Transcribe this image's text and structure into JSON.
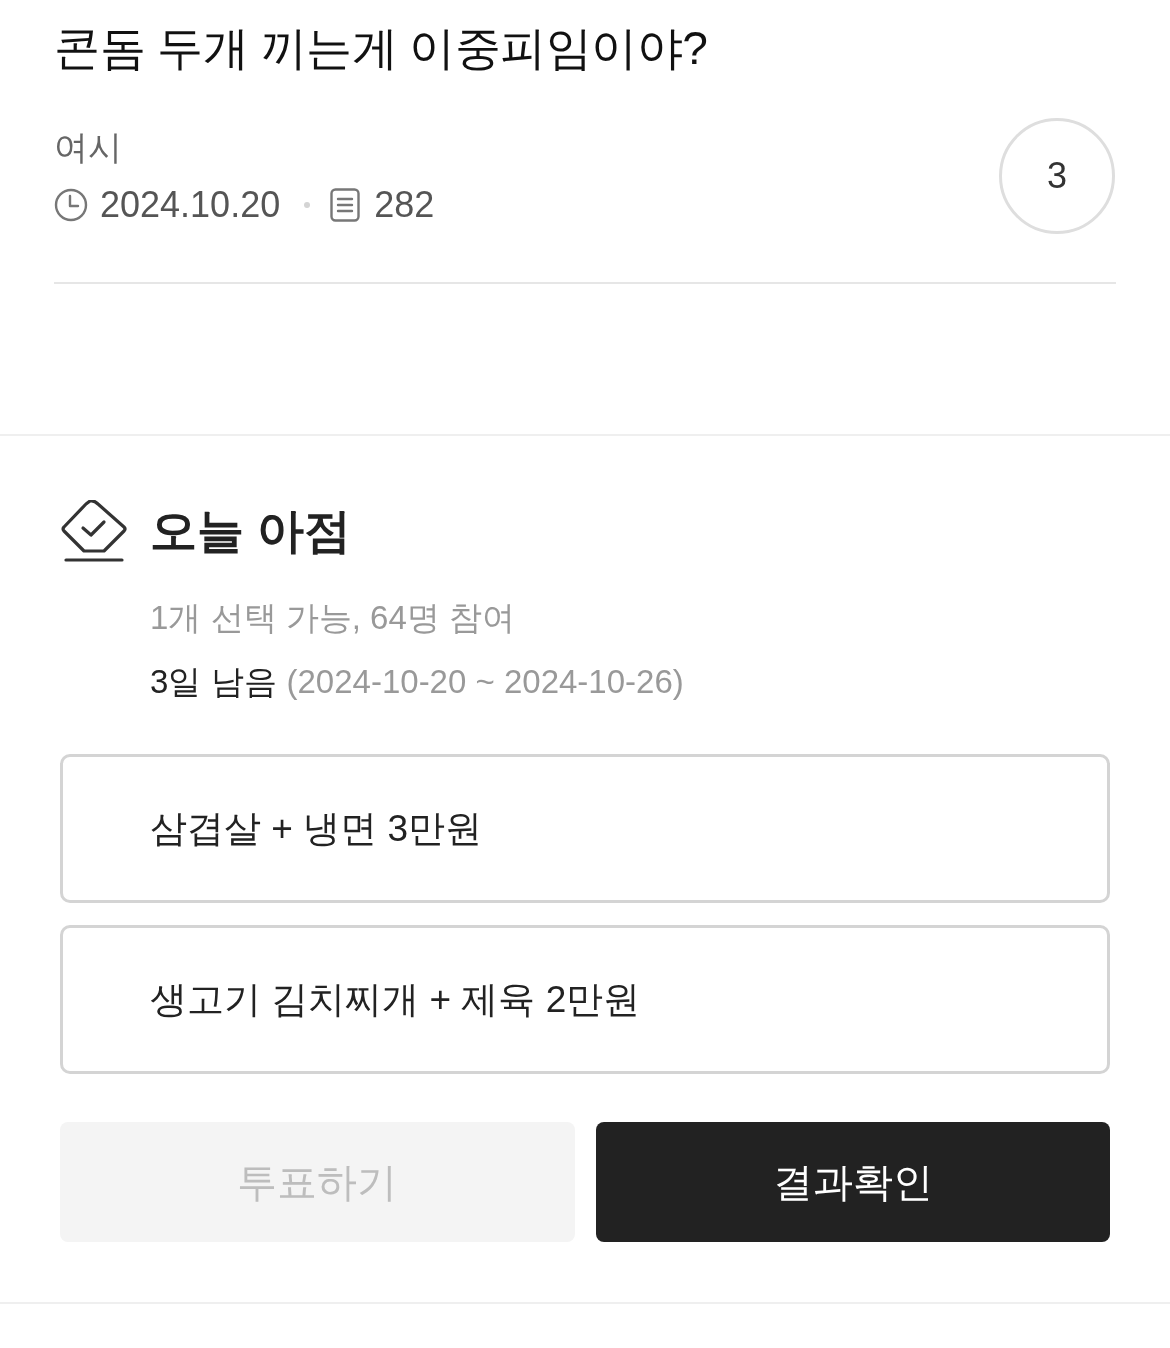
{
  "post": {
    "title": "콘돔 두개 끼는게 이중피임이야?",
    "author": "여시",
    "date": "2024.10.20",
    "views": "282",
    "comment_count": "3"
  },
  "poll": {
    "title": "오늘 아점",
    "info": "1개 선택 가능, 64명 참여",
    "remaining": "3일 남음",
    "period": "(2024-10-20 ~ 2024-10-26)",
    "options": [
      {
        "label": "삼겹살 + 냉면 3만원",
        "selected": false
      },
      {
        "label": "생고기 김치찌개 + 제육 2만원",
        "selected": false
      }
    ],
    "buttons": [
      {
        "label": "투표하기",
        "kind": "vote",
        "disabled": true
      },
      {
        "label": "결과확인",
        "kind": "results",
        "disabled": false
      }
    ]
  }
}
